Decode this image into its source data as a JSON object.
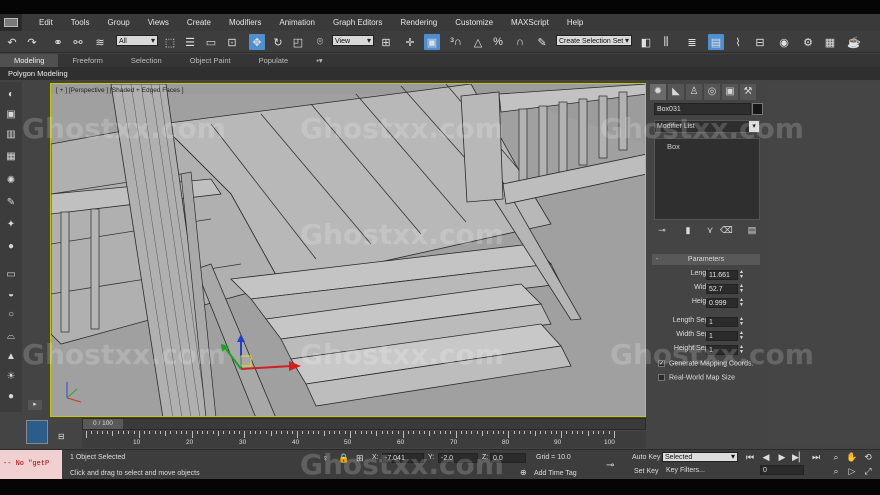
{
  "menu": [
    "Edit",
    "Tools",
    "Group",
    "Views",
    "Create",
    "Modifiers",
    "Animation",
    "Graph Editors",
    "Rendering",
    "Customize",
    "MAXScript",
    "Help"
  ],
  "toolbar": {
    "filter_select": "All",
    "ref_coord_select": "View",
    "selection_set_placeholder": "Create Selection Set"
  },
  "ribbon_tabs": [
    "Modeling",
    "Freeform",
    "Selection",
    "Object Paint",
    "Populate"
  ],
  "ribbon_sub": "Polygon Modeling",
  "viewport": {
    "label": "[ + ] [Perspective ] [Shaded + Edged Faces ]",
    "colors": {
      "floor": "#a3a3a3",
      "wood": "#b5b5b5",
      "edge": "#2a2a2a",
      "border": "#c8c800"
    }
  },
  "command_panel": {
    "object_name": "Box031",
    "modifier_list": "Modifier List",
    "stack_items": [
      "Box"
    ],
    "parameters_title": "Parameters",
    "parameters": [
      {
        "label": "Length:",
        "value": "11.661"
      },
      {
        "label": "Width:",
        "value": "52.7"
      },
      {
        "label": "Height:",
        "value": "0.999"
      }
    ],
    "segments": [
      {
        "label": "Length Segs:",
        "value": "1"
      },
      {
        "label": "Width Segs:",
        "value": "1"
      },
      {
        "label": "Height Segs:",
        "value": "1"
      }
    ],
    "checkboxes": [
      {
        "label": "Generate Mapping Coords.",
        "checked": "✓"
      },
      {
        "label": "Real-World Map Size",
        "checked": ""
      }
    ]
  },
  "timeline": {
    "slider": "0 / 100",
    "ticks": [
      "10",
      "20",
      "30",
      "40",
      "50",
      "60",
      "70",
      "80",
      "90",
      "100"
    ]
  },
  "status": {
    "maxscript": "-- No \"getP",
    "selection": "1 Object Selected",
    "prompt": "Click and drag to select and move objects",
    "x_label": "X:",
    "x_value": "-7.041",
    "y_label": "Y:",
    "y_value": "-2.0",
    "z_label": "Z:",
    "z_value": "0.0",
    "grid": "Grid = 10.0",
    "add_time_tag": "Add Time Tag",
    "auto_key": "Auto Key",
    "set_key": "Set Key",
    "key_mode": "Selected",
    "key_filters": "Key Filters...",
    "frame": "0"
  },
  "watermark": "Ghostxx.com"
}
